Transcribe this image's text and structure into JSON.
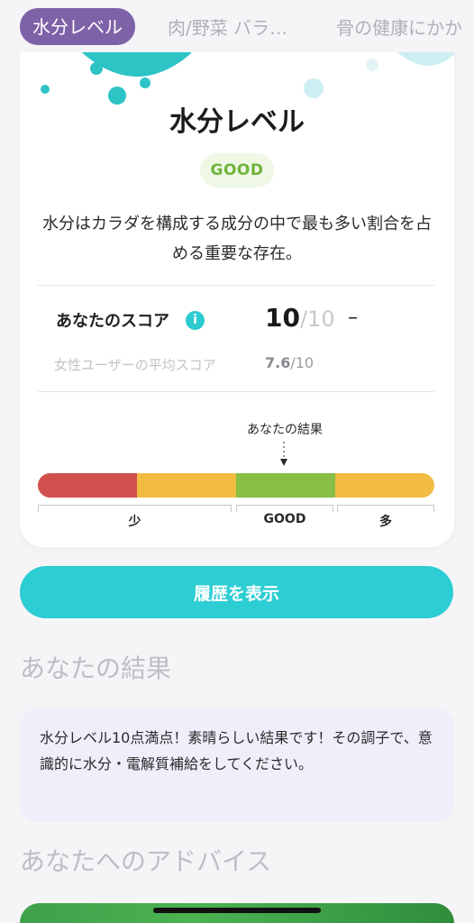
{
  "tabs": [
    {
      "label": "水分レベル",
      "active": true
    },
    {
      "label": "肉/野菜 バラ…",
      "active": false
    },
    {
      "label": "骨の健康にかか",
      "active": false
    }
  ],
  "card": {
    "title": "水分レベル",
    "badge": "GOOD",
    "description": "水分はカラダを構成する成分の中で最も多い割合を占める重要な存在。",
    "score_label": "あなたのスコア",
    "info_icon": "i",
    "score": "10",
    "score_max": "/10",
    "score_change": "–",
    "avg_label": "女性ユーザーの平均スコア",
    "avg_score": "7.6",
    "avg_max": "/10",
    "result_marker": "あなたの結果",
    "scale": [
      "少",
      "GOOD",
      "多"
    ],
    "bar_colors": [
      "#d14f4c",
      "#f2bc43",
      "#86bf43",
      "#f2bc43"
    ]
  },
  "history_button": "履歴を表示",
  "result_section": {
    "title": "あなたの結果",
    "text": "水分レベル10点満点！素晴らしい結果です！その調子で、意識的に水分・電解質補給をしてください。"
  },
  "advice_section": {
    "title": "あなたへのアドバイス"
  },
  "colors": {
    "accent": "#2ccdd3",
    "tab_active": "#7e62a8",
    "good": "#6fb43a"
  }
}
